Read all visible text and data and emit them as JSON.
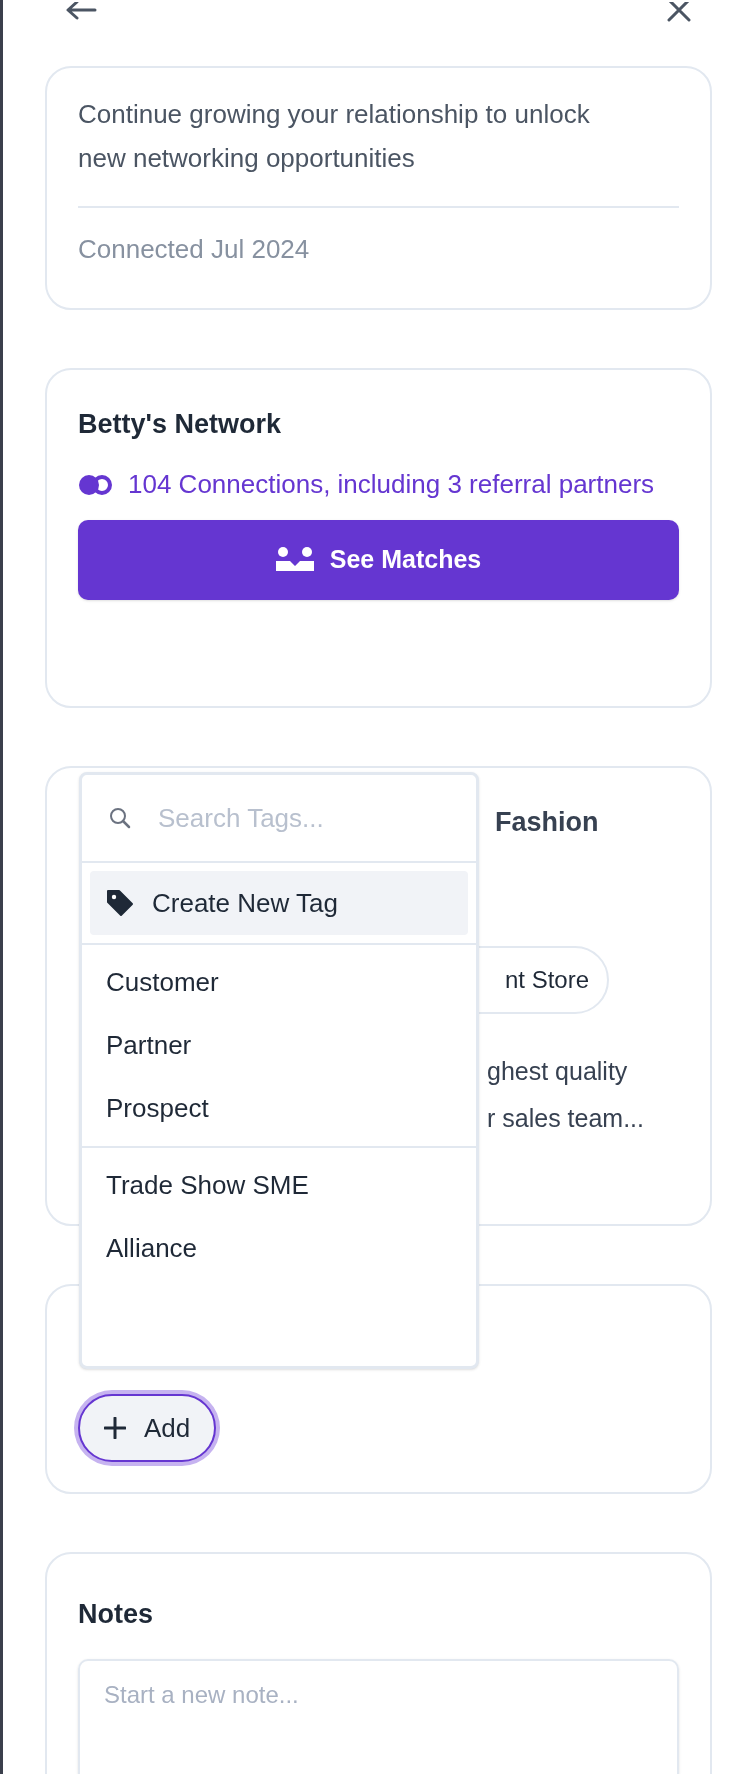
{
  "relationship_card": {
    "message": "Continue growing your relationship to unlock new networking opportunities",
    "connected": "Connected Jul 2024"
  },
  "network_card": {
    "title": "Betty's Network",
    "connections": "104 Connections, including 3 referral partners",
    "button": "See Matches"
  },
  "company_card": {
    "title_fragment": "Fashion",
    "chip_fragment": "nt Store",
    "description_lines": [
      "ghest quality",
      "r sales team..."
    ]
  },
  "tags_card": {
    "add_button": {
      "label": "Add",
      "focused": true
    }
  },
  "tag_dropdown": {
    "search": {
      "placeholder": "Search Tags..."
    },
    "create_item": {
      "label": "Create New Tag",
      "highlighted": true
    },
    "groups": [
      [
        {
          "label": "Customer"
        },
        {
          "label": "Partner"
        },
        {
          "label": "Prospect"
        }
      ],
      [
        {
          "label": "Trade Show SME"
        },
        {
          "label": "Alliance"
        }
      ]
    ]
  },
  "notes_card": {
    "title": "Notes",
    "note_field": {
      "placeholder": "Start a new note..."
    }
  }
}
